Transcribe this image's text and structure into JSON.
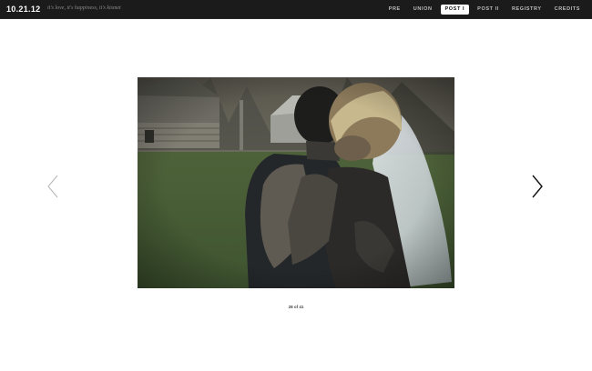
{
  "header": {
    "logo": "10.21.12",
    "tagline": "it's love, it's happiness, it's kismet"
  },
  "nav": {
    "items": [
      {
        "label": "PRE",
        "active": false
      },
      {
        "label": "UNION",
        "active": false
      },
      {
        "label": "POST I",
        "active": true
      },
      {
        "label": "POST II",
        "active": false
      },
      {
        "label": "REGISTRY",
        "active": false
      },
      {
        "label": "CREDITS",
        "active": false
      }
    ]
  },
  "gallery": {
    "counter": "28 of 41",
    "prev_icon": "chevron-left-icon",
    "next_icon": "chevron-right-icon"
  },
  "colors": {
    "header_bg": "#1b1b1b",
    "nav_active_bg": "#ffffff",
    "page_bg": "#ffffff"
  }
}
